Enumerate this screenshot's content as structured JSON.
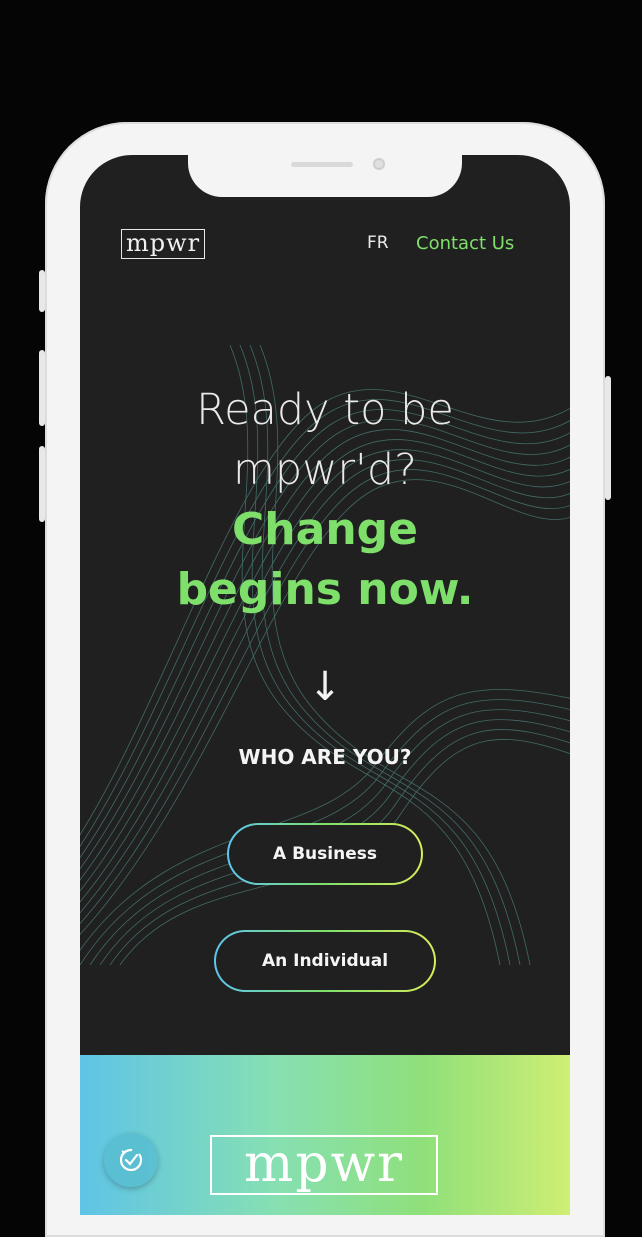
{
  "header": {
    "logo": "mpwr",
    "lang": "FR",
    "contact": "Contact Us"
  },
  "hero": {
    "line1": "Ready to be",
    "line2": "mpwr'd?",
    "line3": "Change",
    "line4": "begins now."
  },
  "arrow": "↓",
  "question": "WHO ARE YOU?",
  "buttons": {
    "business": "A Business",
    "individual": "An Individual"
  },
  "footer": {
    "logo": "mpwr"
  },
  "colors": {
    "accent": "#7ee06a",
    "background": "#202020"
  }
}
